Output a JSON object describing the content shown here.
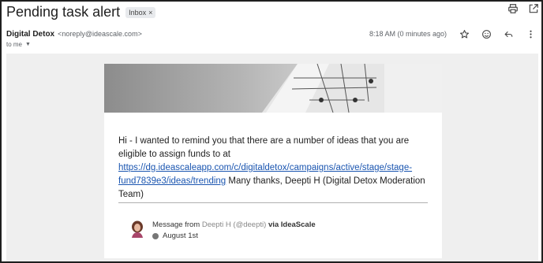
{
  "email": {
    "subject": "Pending task alert",
    "label_chip": "Inbox",
    "chip_close": "×",
    "sender_name": "Digital Detox",
    "sender_email": "<noreply@ideascale.com>",
    "time": "8:18 AM (0 minutes ago)",
    "to": "to me",
    "to_caret": "▼"
  },
  "message": {
    "text_before_link": "Hi - I wanted to remind you that there are a number of ideas that you are eligible to assign funds to at ",
    "link_text": "https://dg.ideascaleapp.com/c/digitaldetox/campaigns/active/stage/stage-fund7839e3/ideas/trending",
    "text_after_link": " Many thanks, Deepti H (Digital Detox Moderation Team)"
  },
  "footer": {
    "message_from": "Message from",
    "author": "Deepti H (@deepti)",
    "via": "via IdeaScale",
    "date": "August 1st"
  },
  "icons": {
    "print": "print-icon",
    "popout": "open-in-new-window-icon",
    "star": "star-icon",
    "emoji": "emoji-icon",
    "reply": "reply-icon",
    "more": "more-vert-icon",
    "avatar": "user-avatar",
    "presence": "status-dot-icon"
  },
  "colors": {
    "link": "#1a55b0",
    "body_background": "#efefef"
  }
}
